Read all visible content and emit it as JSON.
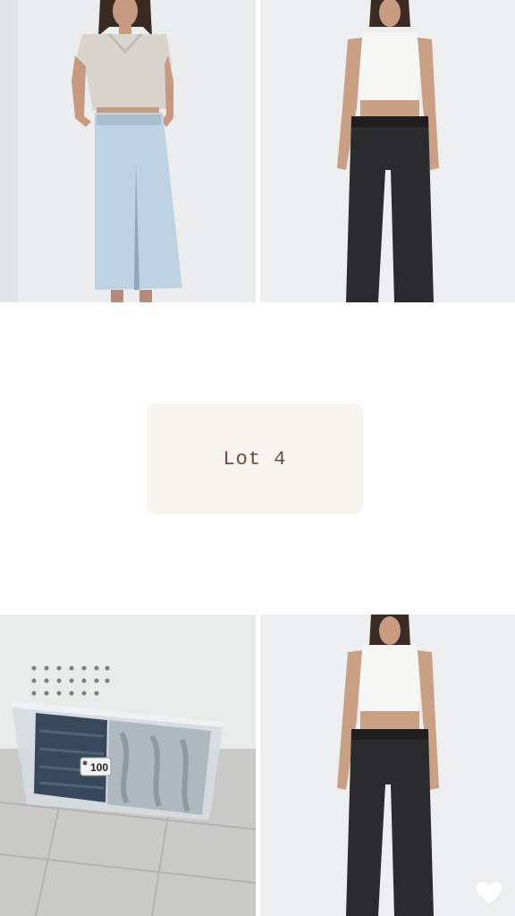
{
  "lot": {
    "label": "Lot 4"
  },
  "bin_tag": {
    "number": "100"
  },
  "colors": {
    "card_bg": "#f8f4ef",
    "card_text": "#6a4a3c"
  },
  "icons": {
    "favorite": "heart-icon"
  }
}
